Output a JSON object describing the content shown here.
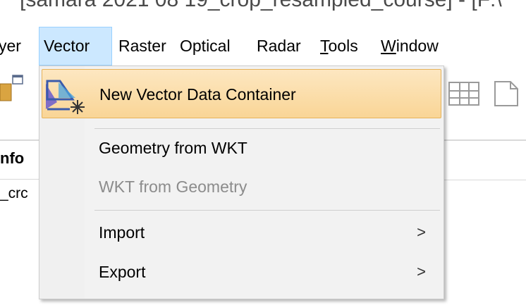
{
  "window": {
    "title_fragment": "[samara 2021 08 19_crop_resampled_course]  - [F:\\"
  },
  "menubar": {
    "items": [
      {
        "label": "yer"
      },
      {
        "label": "Vector"
      },
      {
        "label": "Raster"
      },
      {
        "label": "Optical"
      },
      {
        "label": "Radar"
      },
      {
        "label": "Tools",
        "accel": "T",
        "rest": "ools"
      },
      {
        "label": "Window",
        "accel": "W",
        "rest": "indow"
      }
    ],
    "active_item": "Vector"
  },
  "background": {
    "panel_header": "nfo",
    "panel_value": "_crc"
  },
  "dropdown": {
    "items": [
      {
        "label": "New Vector Data Container",
        "icon": "new-vector-container-icon",
        "highlighted": true,
        "enabled": true
      },
      {
        "label": "Geometry from WKT",
        "enabled": true
      },
      {
        "label": "WKT from Geometry",
        "enabled": false
      },
      {
        "label": "Import",
        "enabled": true,
        "submenu_arrow": ">"
      },
      {
        "label": "Export",
        "enabled": true,
        "submenu_arrow": ">"
      }
    ]
  },
  "colors": {
    "menu_active_bg": "#cce8ff",
    "menu_active_border": "#99d1ff",
    "highlight_top": "#fde7c1",
    "highlight_bottom": "#f9d596",
    "highlight_border": "#e6b35c",
    "disabled_text": "#8c8c8c"
  }
}
